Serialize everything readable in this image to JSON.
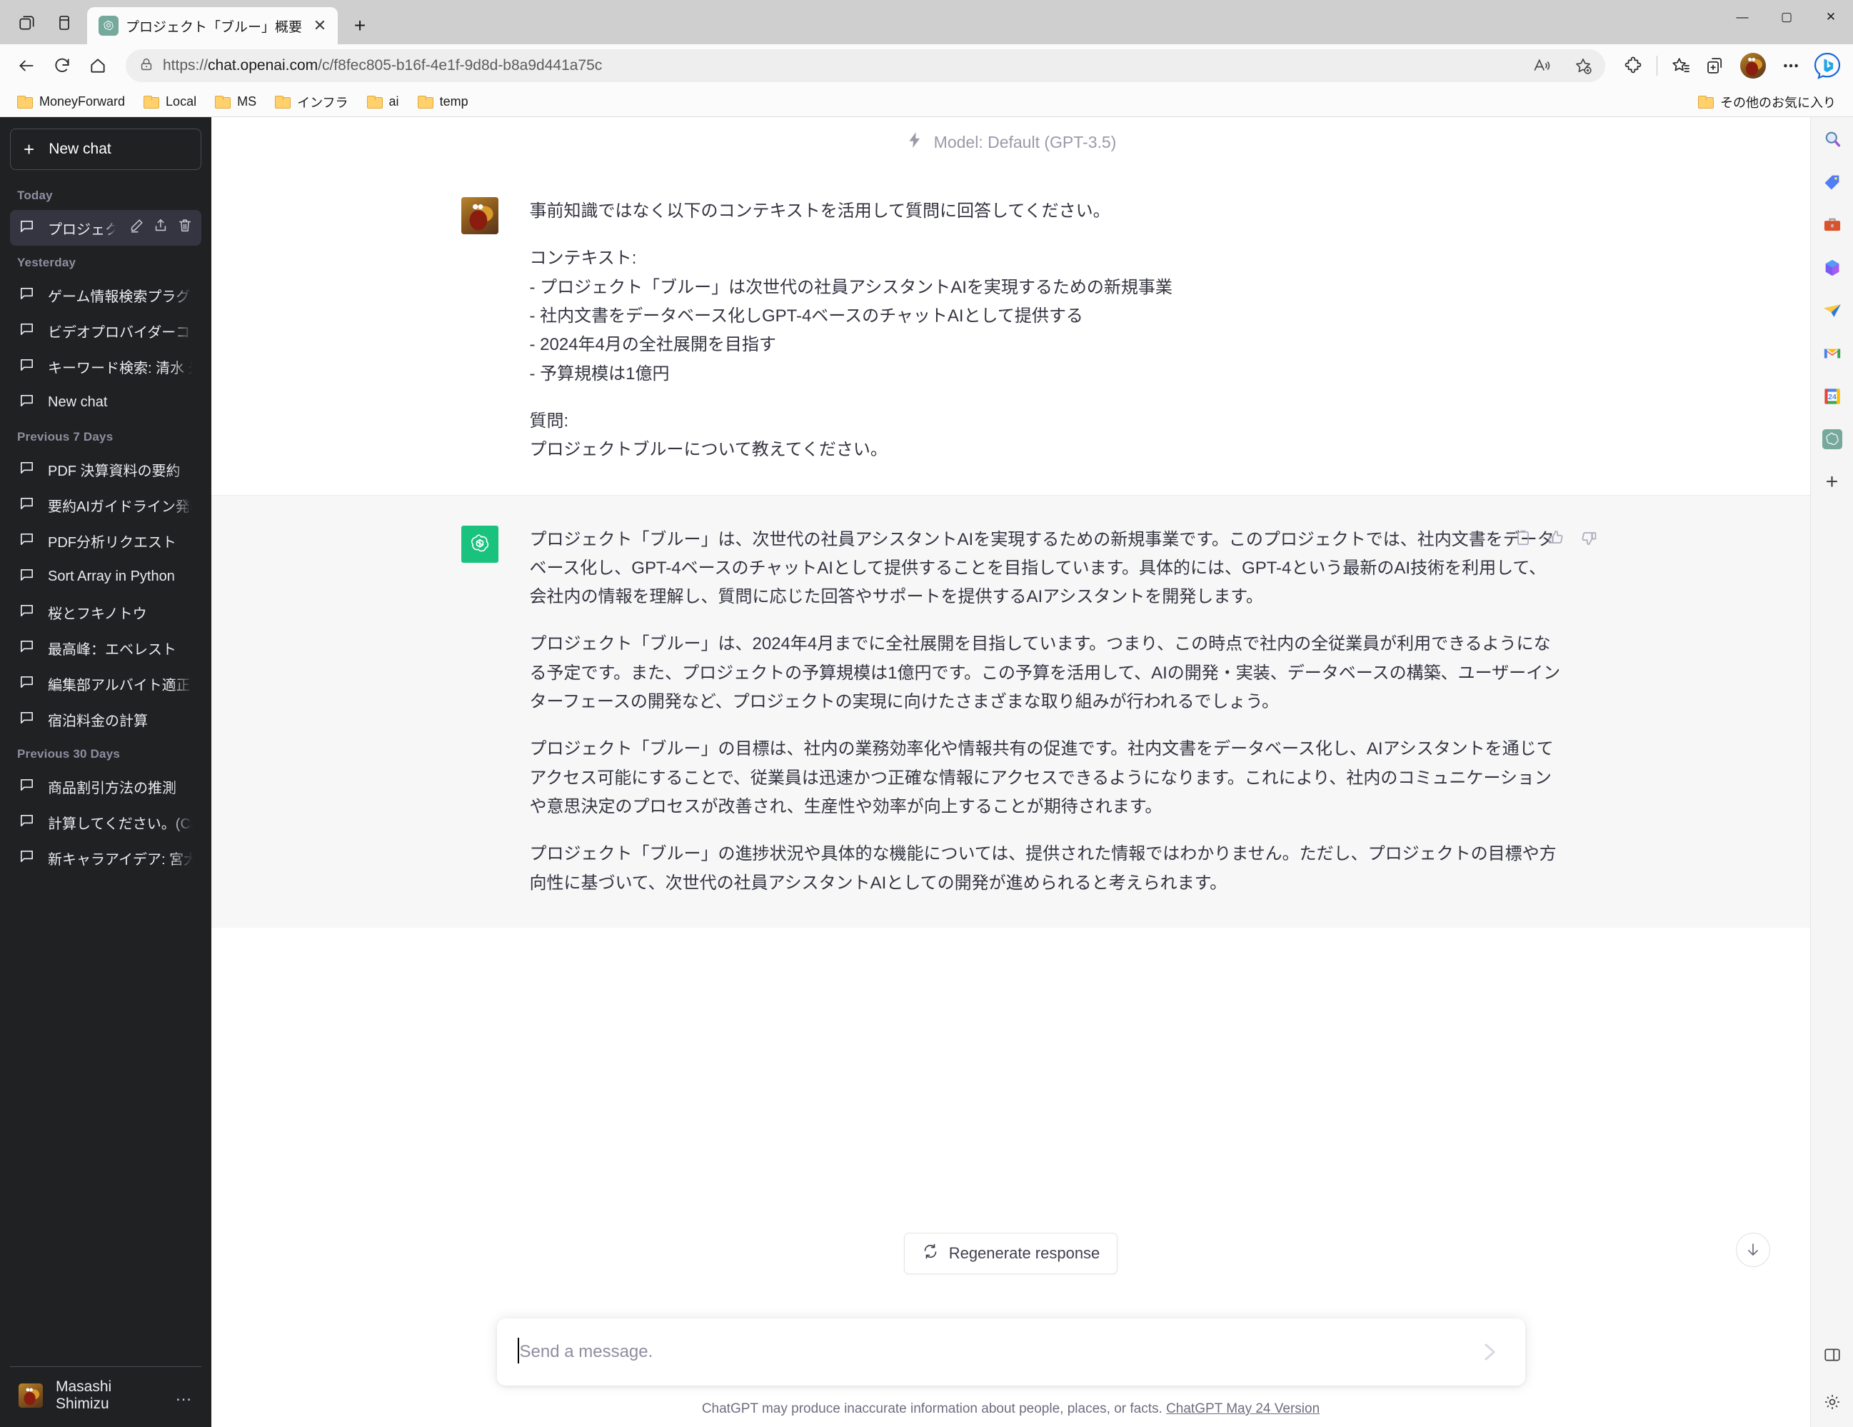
{
  "browser": {
    "tab": {
      "title": "プロジェクト「ブルー」概要",
      "favicon_name": "openai-favicon",
      "close_label": "✕"
    },
    "new_tab_label": "+",
    "window_buttons": {
      "minimize": "—",
      "maximize": "▢",
      "close": "✕"
    },
    "nav": {
      "back_title": "Back",
      "refresh_title": "Refresh",
      "home_title": "Home",
      "url_scheme": "https://",
      "url_host": "chat.openai.com",
      "url_path": "/c/f8fec805-b16f-4e1f-9d8d-b8a9d441a75c",
      "url_full": "https://chat.openai.com/c/f8fec805-b16f-4e1f-9d8d-b8a9d441a75c"
    },
    "bookmarks": [
      {
        "label": "MoneyForward"
      },
      {
        "label": "Local"
      },
      {
        "label": "MS"
      },
      {
        "label": "インフラ"
      },
      {
        "label": "ai"
      },
      {
        "label": "temp"
      }
    ],
    "bookmarks_overflow": "その他のお気に入り"
  },
  "sidebar": {
    "new_chat": "New chat",
    "groups": [
      {
        "label": "Today",
        "items": [
          {
            "label": "プロジェクト「ブルー」概要",
            "active": true
          }
        ]
      },
      {
        "label": "Yesterday",
        "items": [
          {
            "label": "ゲーム情報検索プラグイン",
            "active": false
          },
          {
            "label": "ビデオプロバイダーコンテンツ取得",
            "active": false
          },
          {
            "label": "キーワード検索: 清水 光ファイバー",
            "active": false
          },
          {
            "label": "New chat",
            "active": false
          }
        ]
      },
      {
        "label": "Previous 7 Days",
        "items": [
          {
            "label": "PDF 決算資料の要約",
            "active": false
          },
          {
            "label": "要約AIガイドライン発表",
            "active": false
          },
          {
            "label": "PDF分析リクエスト",
            "active": false
          },
          {
            "label": "Sort Array in Python",
            "active": false
          },
          {
            "label": "桜とフキノトウ",
            "active": false
          },
          {
            "label": "最高峰：エベレスト",
            "active": false
          },
          {
            "label": "編集部アルバイト適正",
            "active": false
          },
          {
            "label": "宿泊料金の計算",
            "active": false
          }
        ]
      },
      {
        "label": "Previous 30 Days",
        "items": [
          {
            "label": "商品割引方法の推測",
            "active": false
          },
          {
            "label": "計算してください。(Calculate, ple",
            "active": false
          },
          {
            "label": "新キャラアイデア: 宮大工動物王子",
            "active": false
          }
        ]
      }
    ],
    "user_name": "Masashi Shimizu",
    "user_menu_dots": "…"
  },
  "main": {
    "model_label": "Model: Default (GPT-3.5)",
    "model_icon": "lightning-bolt-icon",
    "messages": [
      {
        "role": "user",
        "avatar_name": "user-avatar",
        "paragraphs": [
          [
            "事前知識ではなく以下のコンテキストを活用して質問に回答してください。"
          ],
          [
            "コンテキスト:",
            "- プロジェクト「ブルー」は次世代の社員アシスタントAIを実現するための新規事業",
            "- 社内文書をデータベース化しGPT-4ベースのチャットAIとして提供する",
            "- 2024年4月の全社展開を目指す",
            "- 予算規模は1億円"
          ],
          [
            "質問:",
            "プロジェクトブルーについて教えてください。"
          ]
        ]
      },
      {
        "role": "assistant",
        "avatar_name": "chatgpt-avatar",
        "actions": [
          "copy-icon",
          "thumbs-up-icon",
          "thumbs-down-icon"
        ],
        "paragraphs": [
          [
            "プロジェクト「ブルー」は、次世代の社員アシスタントAIを実現するための新規事業です。このプロジェクトでは、社内文書をデータベース化し、GPT-4ベースのチャットAIとして提供することを目指しています。具体的には、GPT-4という最新のAI技術を利用して、会社内の情報を理解し、質問に応じた回答やサポートを提供するAIアシスタントを開発します。"
          ],
          [
            "プロジェクト「ブルー」は、2024年4月までに全社展開を目指しています。つまり、この時点で社内の全従業員が利用できるようになる予定です。また、プロジェクトの予算規模は1億円です。この予算を活用して、AIの開発・実装、データベースの構築、ユーザーインターフェースの開発など、プロジェクトの実現に向けたさまざまな取り組みが行われるでしょう。"
          ],
          [
            "プロジェクト「ブルー」の目標は、社内の業務効率化や情報共有の促進です。社内文書をデータベース化し、AIアシスタントを通じてアクセス可能にすることで、従業員は迅速かつ正確な情報にアクセスできるようになります。これにより、社内のコミュニケーションや意思決定のプロセスが改善され、生産性や効率が向上することが期待されます。"
          ],
          [
            "プロジェクト「ブルー」の進捗状況や具体的な機能については、提供された情報ではわかりません。ただし、プロジェクトの目標や方向性に基づいて、次世代の社員アシスタントAIとしての開発が進められると考えられます。"
          ]
        ]
      }
    ],
    "regenerate_label": "Regenerate response",
    "regenerate_icon": "refresh-icon",
    "scroll_down_icon": "arrow-down-icon",
    "composer_placeholder": "Send a message.",
    "send_icon": "send-arrow-icon",
    "disclaimer_text": "ChatGPT may produce inaccurate information about people, places, or facts. ",
    "disclaimer_link": "ChatGPT May 24 Version"
  },
  "edge_rail": {
    "items": [
      {
        "name": "search-icon",
        "glyph": "🔍"
      },
      {
        "name": "shopping-tag-icon",
        "glyph": "🏷"
      },
      {
        "name": "tools-briefcase-icon",
        "glyph": "🧰"
      },
      {
        "name": "microsoft-365-icon",
        "glyph": ""
      },
      {
        "name": "outlook-send-icon",
        "glyph": ""
      },
      {
        "name": "gmail-icon",
        "glyph": "M"
      },
      {
        "name": "google-calendar-icon",
        "glyph": "24"
      },
      {
        "name": "chatgpt-app-icon",
        "glyph": ""
      },
      {
        "name": "add-app-icon",
        "glyph": "+"
      }
    ],
    "bottom": [
      {
        "name": "split-screen-icon",
        "glyph": ""
      },
      {
        "name": "settings-gear-icon",
        "glyph": ""
      }
    ]
  },
  "colors": {
    "sidebar_bg": "#202123",
    "sidebar_active": "#343541",
    "assistant_bg": "#f7f7f8",
    "gpt_green": "#19c37d",
    "text_dark": "#343541",
    "muted": "#8e8ea0"
  }
}
